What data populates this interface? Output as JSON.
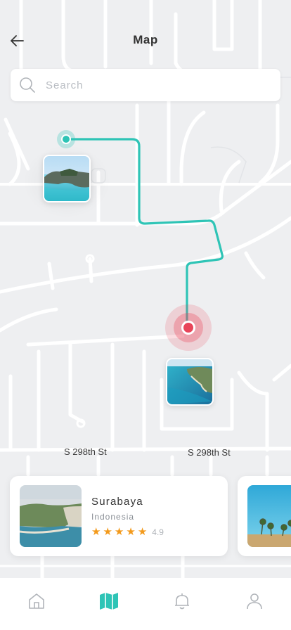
{
  "header": {
    "title": "Map"
  },
  "search": {
    "placeholder": "Search",
    "value": ""
  },
  "streets": {
    "label_left": "S 298th St",
    "label_right": "S 298th St"
  },
  "cards": [
    {
      "name": "Surabaya",
      "country": "Indonesia",
      "rating": "4.9",
      "stars": 5
    }
  ],
  "tabs": [
    {
      "name": "home",
      "icon": "home-icon",
      "active": false
    },
    {
      "name": "map",
      "icon": "map-icon",
      "active": true
    },
    {
      "name": "notifications",
      "icon": "bell-icon",
      "active": false
    },
    {
      "name": "profile",
      "icon": "user-icon",
      "active": false
    }
  ],
  "colors": {
    "accent": "#2ec4b6",
    "route": "#2ec4b6",
    "destination": "#e8455a",
    "star": "#f39a1c",
    "inactive_icon": "#b0b4b9"
  }
}
